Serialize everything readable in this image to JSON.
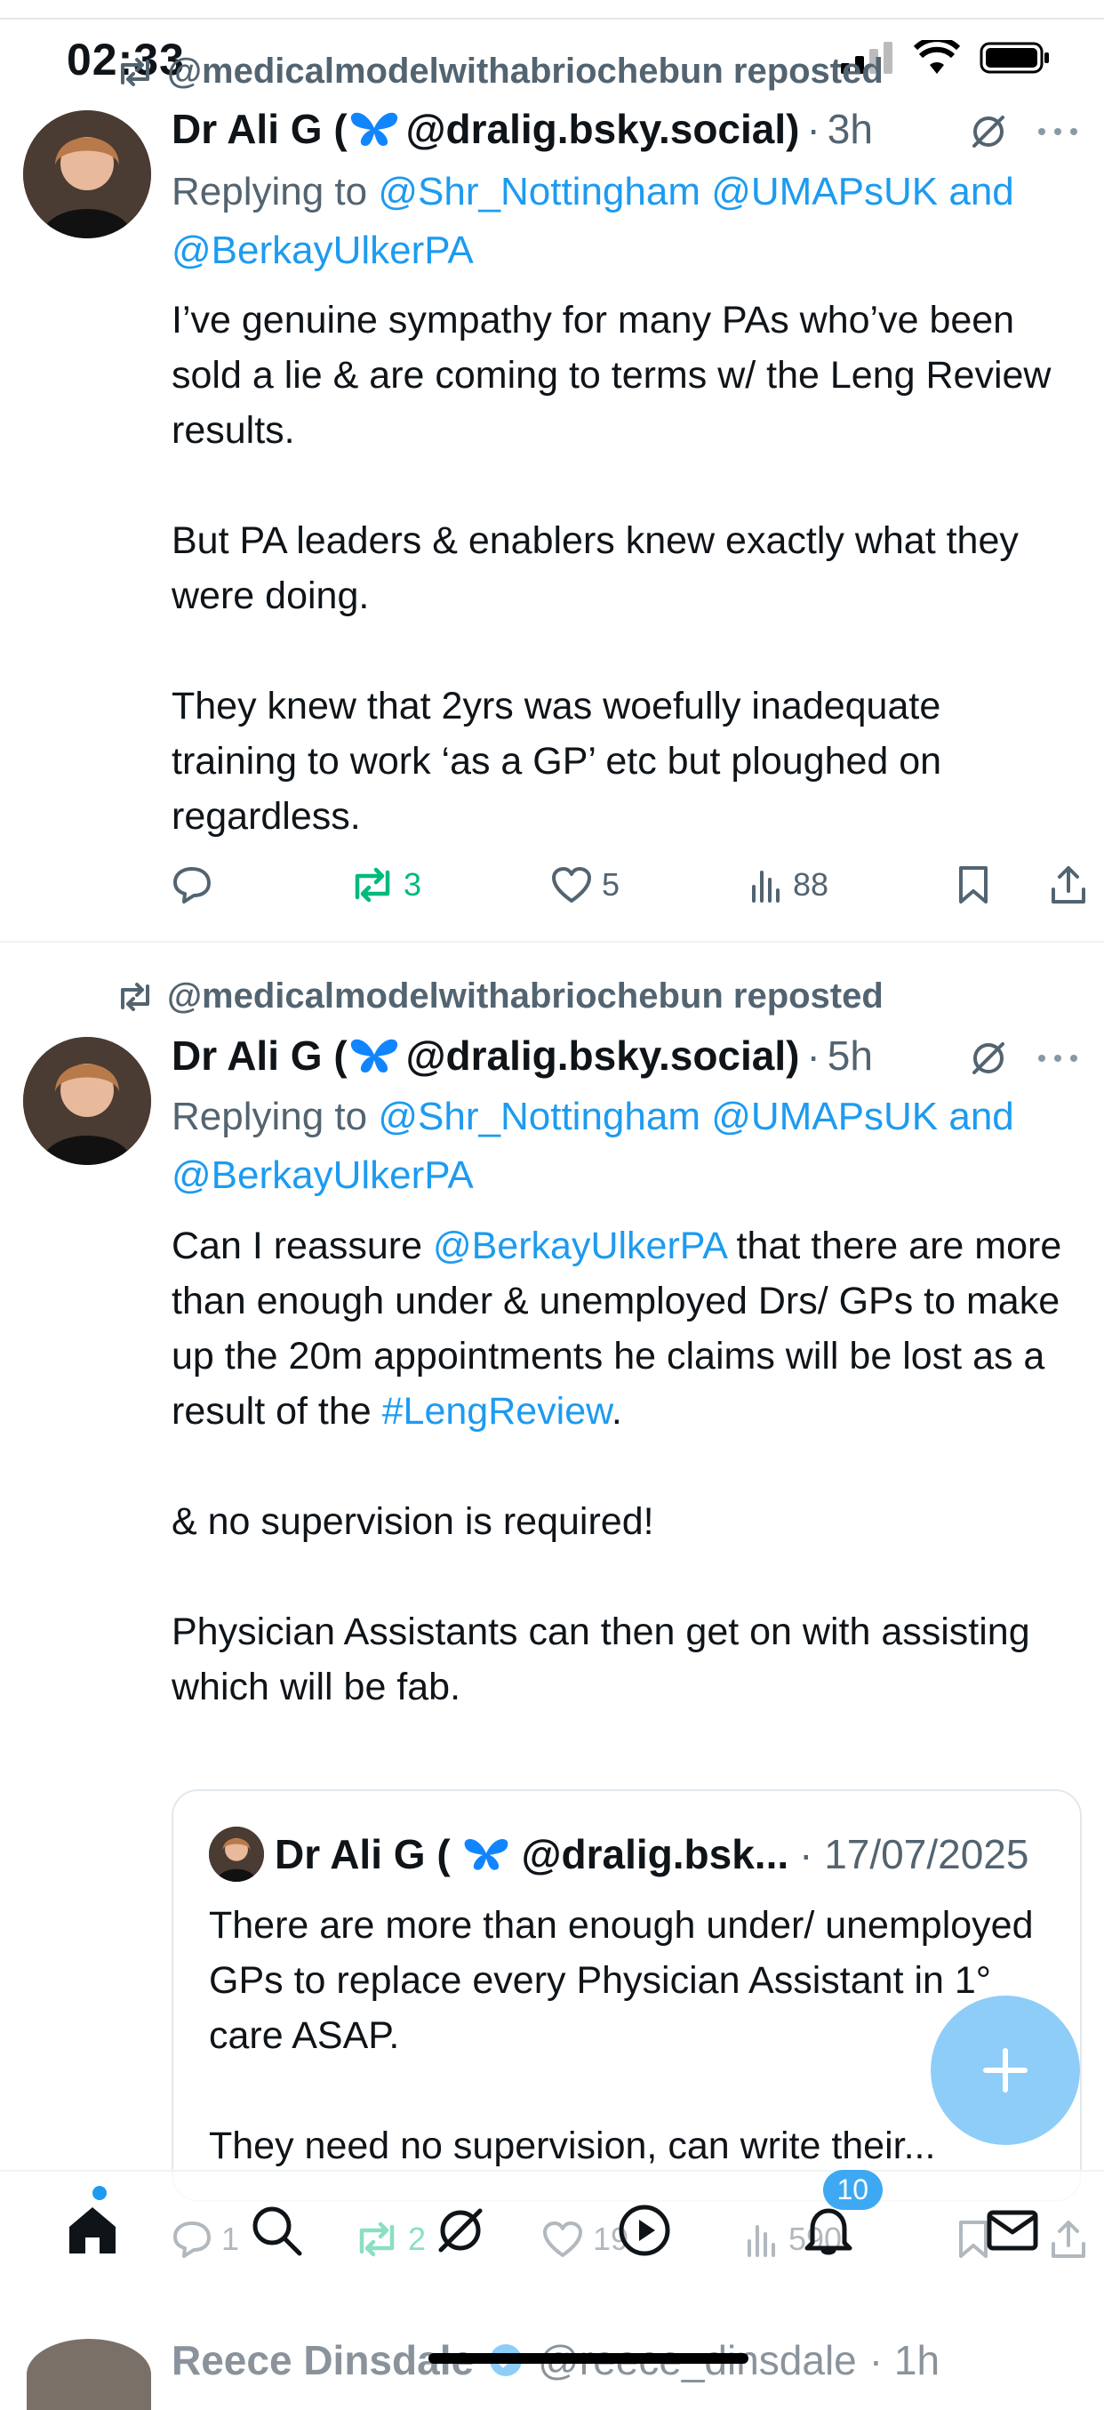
{
  "status_bar": {
    "time": "02:33"
  },
  "tweets": [
    {
      "reposted_by": "@medicalmodelwithabriochebun reposted",
      "author_name": "Dr Ali G (",
      "author_handle": "@dralig.bsky.social)",
      "dot": "·",
      "time_ago": "3h",
      "reply_prefix": "Replying to",
      "reply_mentions": "@Shr_Nottingham @UMAPsUK and @BerkayUlkerPA",
      "paragraphs": [
        "I’ve genuine sympathy for many PAs who’ve been sold a lie & are coming to terms w/ the Leng Review results.",
        "But PA leaders & enablers knew exactly what they were doing.",
        "They knew that 2yrs was woefully inadequate training to work ‘as a GP’ etc but ploughed on regardless."
      ],
      "replies": "",
      "reposts": "3",
      "likes": "5",
      "views": "88"
    },
    {
      "reposted_by": "@medicalmodelwithabriochebun reposted",
      "author_name": "Dr Ali G (",
      "author_handle": "@dralig.bsky.social)",
      "dot": "·",
      "time_ago": "5h",
      "reply_prefix": "Replying to",
      "reply_mentions": "@Shr_Nottingham @UMAPsUK and @BerkayUlkerPA",
      "p1_a": "Can I reassure ",
      "p1_mention": "@BerkayUlkerPA",
      "p1_b": " that there are more than enough under & unemployed Drs/ GPs to make up the 20m appointments he claims will be lost as a result of the ",
      "p1_hashtag": "#LengReview",
      "p1_c": ".",
      "p2": "& no supervision is required!",
      "p3": "Physician Assistants can then get on with assisting which will be fab.",
      "replies": "1",
      "reposts": "2",
      "likes": "19",
      "views": "590"
    }
  ],
  "quote": {
    "author_name": "Dr Ali G (",
    "author_handle": "@dralig.bsk...",
    "date": "· 17/07/2025",
    "p1": "There are more than enough under/ unemployed GPs to replace every Physician Assistant in 1° care ASAP.",
    "p2": "They need no supervision, can write their..."
  },
  "nav": {
    "notifications_badge": "10"
  },
  "next_tweet": {
    "author_name": "Reece Dinsdale",
    "author_handle": "@reece_dinsdale",
    "time_ago": "· 1h"
  },
  "colors": {
    "accent": "#1d9bf0",
    "repost_green": "#00ba7c",
    "fab": "#8ecdf8",
    "muted": "#536471"
  }
}
